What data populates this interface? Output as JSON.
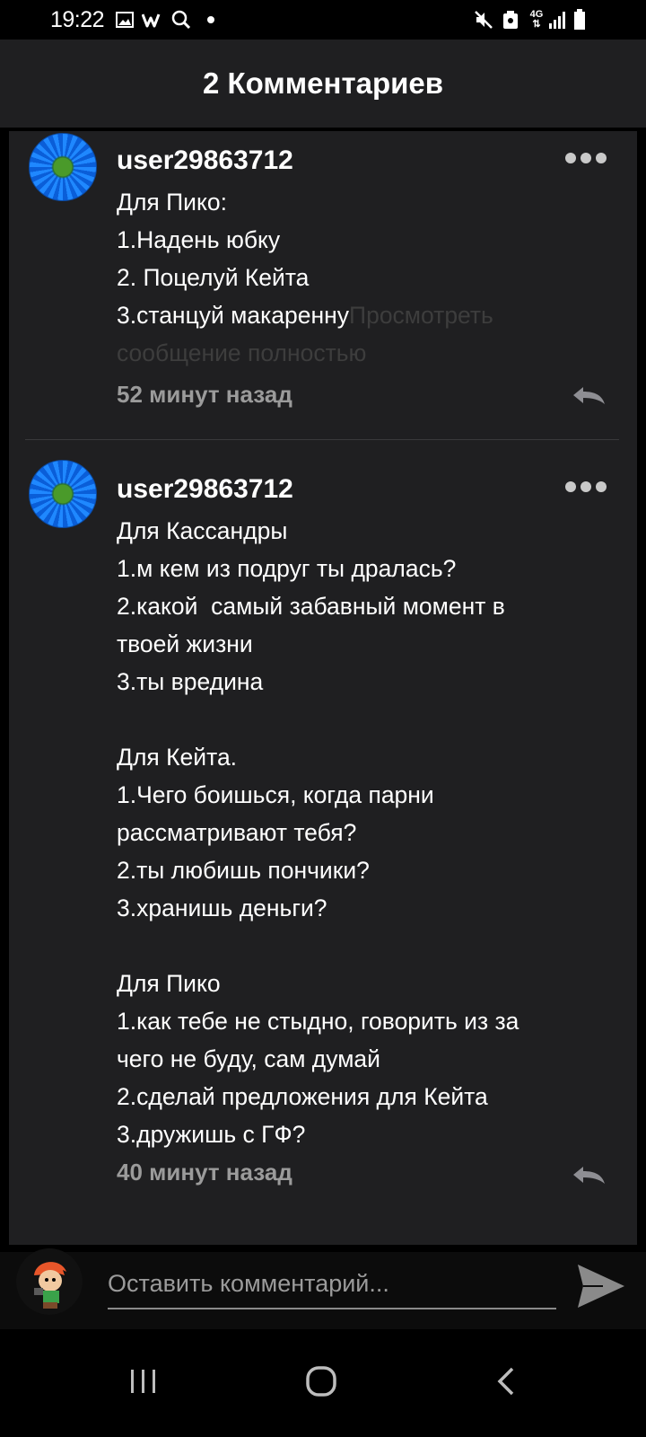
{
  "status_bar": {
    "time": "19:22",
    "icons": [
      "gallery-icon",
      "w-app-icon",
      "search-icon",
      "dot-icon",
      "mute-icon",
      "recycle-icon",
      "4g-icon",
      "signal-icon",
      "battery-icon"
    ],
    "network": "4G"
  },
  "header": {
    "title": "2 Комментариев"
  },
  "comments": [
    {
      "username": "user29863712",
      "lines": [
        "Для Пико:",
        "1.Надень юбку",
        "2. Поцелуй Кейта",
        "3.станцуй макаренну"
      ],
      "more_link_a": "Просмотреть",
      "more_link_b": "сообщение полностью",
      "time": "52 минут назад"
    },
    {
      "username": "user29863712",
      "lines": [
        "Для Кассандры",
        "1.м кем из подруг ты дралась?",
        "2.какой  самый забавный момент в",
        "твоей жизни",
        "3.ты вредина",
        "",
        "Для Кейта.",
        "1.Чего боишься, когда парни",
        "рассматривают тебя?",
        "2.ты любишь пончики?",
        "3.хранишь деньги?",
        "",
        "Для Пико",
        "1.как тебе не стыдно, говорить из за",
        "чего не буду, сам думай",
        "2.сделай предложения для Кейта",
        "3.дружишь с ГФ?"
      ],
      "time": "40 минут назад"
    }
  ],
  "input": {
    "placeholder": "Оставить комментарий..."
  },
  "colors": {
    "background": "#000000",
    "panel": "#1f1f21",
    "accent_icon": "#c9c9c9",
    "muted_text": "#9b9b9b"
  }
}
